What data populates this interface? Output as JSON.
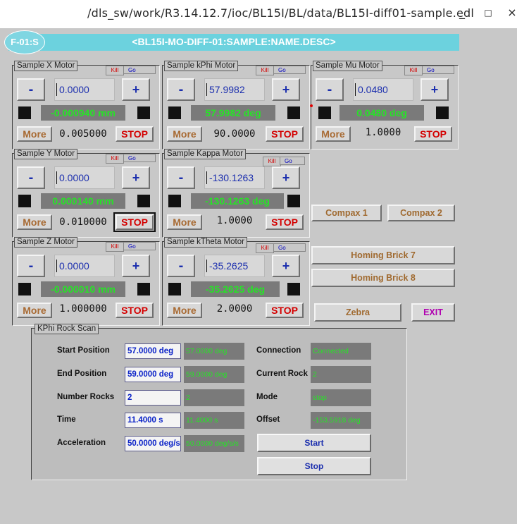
{
  "window": {
    "title": "/dls_sw/work/R3.14.12.7/ioc/BL15I/BL/data/BL15I-diff01-sample.edl",
    "controls": {
      "minimize": "_",
      "maximize": "□",
      "close": "×"
    }
  },
  "header": {
    "title": "<BL15I-MO-DIFF-01:SAMPLE:NAME.DESC>",
    "badge": "F-01:S"
  },
  "motor_labels": {
    "kill": "Kill",
    "go": "Go",
    "minus": "-",
    "plus": "+",
    "more": "More",
    "stop": "STOP"
  },
  "motors": {
    "x": {
      "title": "Sample X Motor",
      "position": "0.0000",
      "readback": "-0.000940 mm",
      "step": "0.005000"
    },
    "kphi": {
      "title": "Sample kPhi Motor",
      "position": "57.9982",
      "readback": "57.9982 deg",
      "step": "90.0000"
    },
    "mu": {
      "title": "Sample Mu Motor",
      "position": "0.0480",
      "readback": "0.0480 deg",
      "step": "1.0000"
    },
    "y": {
      "title": "Sample Y Motor",
      "position": "0.0000",
      "readback": "0.000140 mm",
      "step": "0.010000"
    },
    "kappa": {
      "title": "Sample Kappa Motor",
      "position": "-130.1263",
      "readback": "-130.1263 deg",
      "step": "1.0000"
    },
    "z": {
      "title": "Sample Z Motor",
      "position": "0.0000",
      "readback": "-0.000010 mm",
      "step": "1.000000"
    },
    "ktheta": {
      "title": "Sample kTheta Motor",
      "position": "-35.2625",
      "readback": "-35.2625 deg",
      "step": "2.0000"
    }
  },
  "side_buttons": {
    "compax1": "Compax 1",
    "compax2": "Compax 2",
    "homing7": "Homing Brick 7",
    "homing8": "Homing Brick 8",
    "zebra": "Zebra",
    "exit": "EXIT"
  },
  "rock_scan": {
    "title": "KPhi Rock Scan",
    "start_position": {
      "label": "Start Position",
      "input": "57.0000 deg",
      "readback": "57.0000 deg"
    },
    "end_position": {
      "label": "End Position",
      "input": "59.0000 deg",
      "readback": "59.0000 deg"
    },
    "number_rocks": {
      "label": "Number Rocks",
      "input": "2",
      "readback": "2"
    },
    "time": {
      "label": "Time",
      "input": "11.4000 s",
      "readback": "11.4000 s"
    },
    "acceleration": {
      "label": "Acceleration",
      "input": "50.0000 deg/s",
      "readback": "50.0000 deg/s/s"
    },
    "connection": {
      "label": "Connection",
      "value": "Connected"
    },
    "current_rock": {
      "label": "Current Rock",
      "value": "2"
    },
    "mode": {
      "label": "Mode",
      "value": "stop"
    },
    "offset": {
      "label": "Offset",
      "value": "-153.5918 deg"
    },
    "start_button": "Start",
    "stop_button": "Stop"
  },
  "colors": {
    "header_bg": "#6cd2de",
    "readback_text": "#27e327",
    "readback_bg": "#7a7a7a",
    "input_text": "#1c2fae",
    "stop_text": "#d40000",
    "more_text": "#a86a32",
    "exit_text": "#b000b0"
  },
  "icons": {
    "led": "status-led-icon",
    "error_marker": "red-dot-icon"
  }
}
